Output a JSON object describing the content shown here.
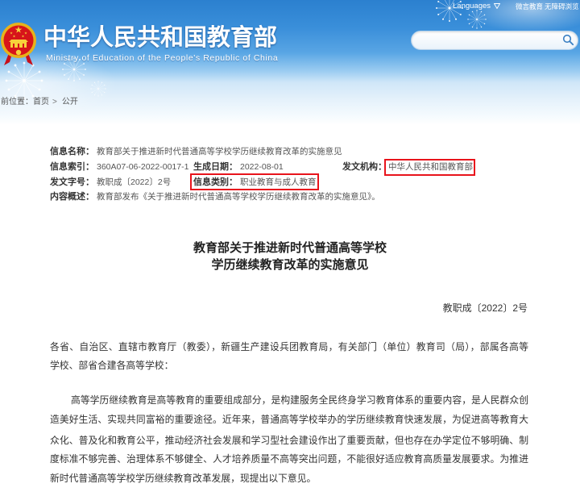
{
  "header": {
    "title": "中华人民共和国教育部",
    "subtitle": "Ministry of Education of the People's Republic of China",
    "emblem_icon": "national-emblem-icon",
    "top_links": {
      "languages": "Languages",
      "languages_icon": "chevron-down-icon",
      "weiyan": "微言教育",
      "accessibility": "无障碍浏览"
    },
    "search": {
      "icon": "search-icon"
    }
  },
  "breadcrumb": {
    "prefix": "当前位置：",
    "home": "首页",
    "separator": ">",
    "current": "公开"
  },
  "info": {
    "name": {
      "label": "信息名称：",
      "value": "教育部关于推进新时代普通高等学校学历继续教育改革的实施意见"
    },
    "index": {
      "label": "信息索引：",
      "value": "360A07-06-2022-0017-1"
    },
    "date": {
      "label": "生成日期：",
      "value": "2022-08-01"
    },
    "agency": {
      "label": "发文机构：",
      "value": "中华人民共和国教育部",
      "highlighted": true
    },
    "doc_no": {
      "label": "发文字号：",
      "value": "教职成〔2022〕2号"
    },
    "category": {
      "label": "信息类别：",
      "value": "职业教育与成人教育",
      "highlighted": true
    },
    "summary": {
      "label": "内容概述：",
      "value": "教育部发布《关于推进新时代普通高等学校学历继续教育改革的实施意见》。"
    }
  },
  "article": {
    "title_lines": [
      "教育部关于推进新时代普通高等学校",
      "学历继续教育改革的实施意见"
    ],
    "doc_number": "教职成〔2022〕2号",
    "paragraphs": [
      [
        "各省、自治区、直辖市教育厅（教委），新疆生产建设兵团教育局，有关部门（单位）教育司（局），部属各高等",
        "学校、部省合建各高等学校："
      ],
      [
        "高等学历继续教育是高等教育的重要组成部分，是构建服务全民终身学习教育体系的重要内容，是人民群众创",
        "造美好生活、实现共同富裕的重要途径。近年来，普通高等学校举办的学历继续教育快速发展，为促进高等教育大",
        "众化、普及化和教育公平，推动经济社会发展和学习型社会建设作出了重要贡献，但也存在办学定位不够明确、制",
        "度标准不够完善、治理体系不够健全、人才培养质量不高等突出问题，不能很好适应教育高质量发展要求。为推进",
        "新时代普通高等学校学历继续教育改革发展，现提出以下意见。"
      ]
    ]
  },
  "colors": {
    "header_blue": "#2b80cf",
    "highlight_red": "#e8141c",
    "header_text": "#ffffff",
    "body_text": "#333333"
  }
}
